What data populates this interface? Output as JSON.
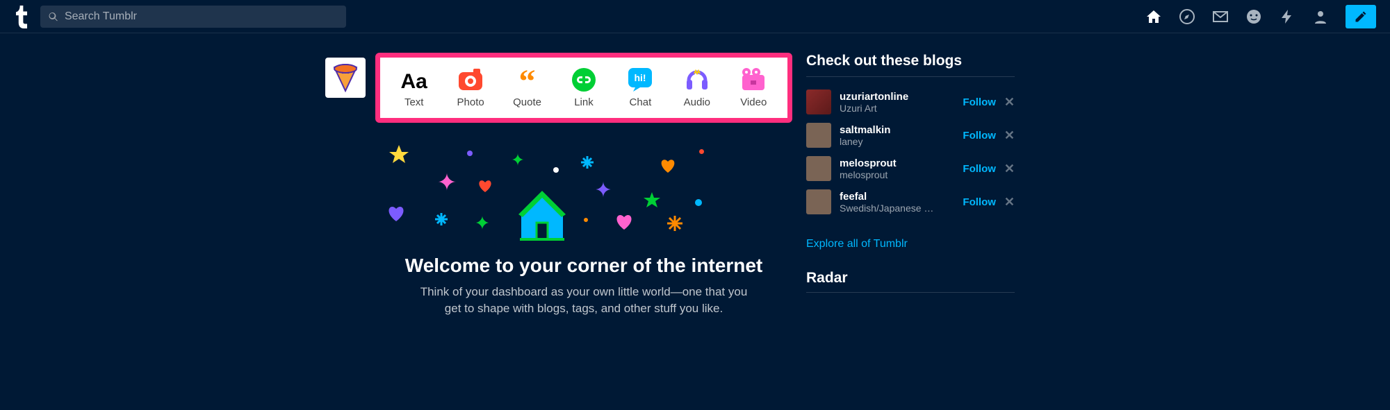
{
  "header": {
    "search_placeholder": "Search Tumblr"
  },
  "compose": {
    "items": [
      {
        "label": "Text"
      },
      {
        "label": "Photo"
      },
      {
        "label": "Quote"
      },
      {
        "label": "Link"
      },
      {
        "label": "Chat"
      },
      {
        "label": "Audio"
      },
      {
        "label": "Video"
      }
    ]
  },
  "welcome": {
    "title": "Welcome to your corner of the internet",
    "subtitle": "Think of your dashboard as your own little world—one that you get to shape with blogs, tags, and other stuff you like."
  },
  "sidebar": {
    "heading": "Check out these blogs",
    "follow_label": "Follow",
    "explore_label": "Explore all of Tumblr",
    "radar_heading": "Radar",
    "blogs": [
      {
        "name": "uzuriartonline",
        "sub": "Uzuri Art"
      },
      {
        "name": "saltmalkin",
        "sub": "laney"
      },
      {
        "name": "melosprout",
        "sub": "melosprout"
      },
      {
        "name": "feefal",
        "sub": "Swedish/Japanese arti..."
      }
    ]
  }
}
